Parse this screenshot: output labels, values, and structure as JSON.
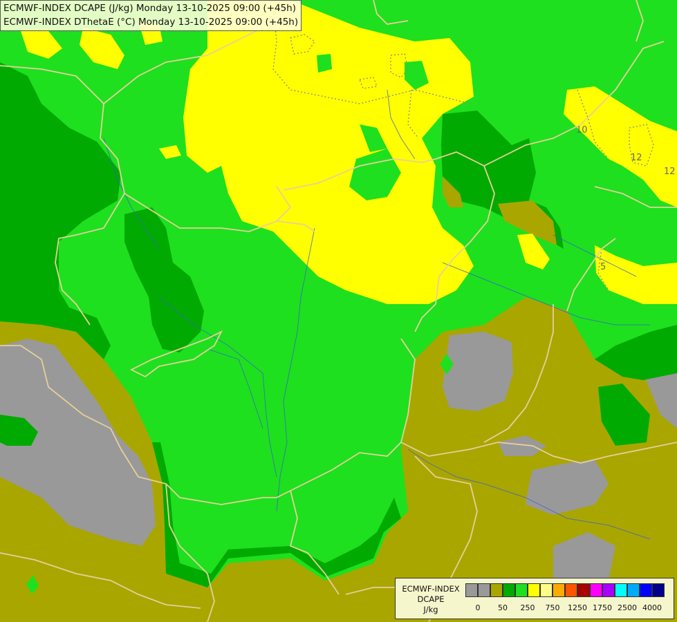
{
  "title": {
    "line1": "ECMWF-INDEX DCAPE (J/kg) Monday 13-10-2025 09:00 (+45h)",
    "line2": "ECMWF-INDEX DThetaE (°C) Monday 13-10-2025 09:00 (+45h)"
  },
  "legend": {
    "model": "ECMWF-INDEX",
    "parameter": "DCAPE",
    "unit": "J/kg",
    "swatch_colors": [
      "#999999",
      "#999999",
      "#aaa600",
      "#00aa00",
      "#1ee01e",
      "#ffff00",
      "#ffff88",
      "#ffaa00",
      "#ff5500",
      "#aa0000",
      "#ff00ff",
      "#aa00ff",
      "#00ffff",
      "#00aaff",
      "#0000ff",
      "#000088"
    ],
    "ticks": [
      "0",
      "50",
      "250",
      "750",
      "1250",
      "1750",
      "2500",
      "4000"
    ]
  },
  "contour_labels": [
    "10",
    "12",
    "12",
    "5"
  ],
  "colors": {
    "gray": "#999999",
    "olive": "#aaa600",
    "dark_green": "#00aa00",
    "green": "#1ee01e",
    "yellow": "#ffff00",
    "border": "#e8cf9a",
    "river": "#3a5fd0"
  }
}
